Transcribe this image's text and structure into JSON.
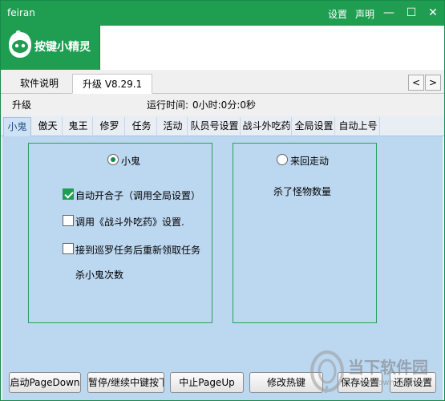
{
  "titlebar": {
    "app_name": "feiran",
    "settings_label": "设置",
    "statement_label": "声明",
    "minimize": "—",
    "maximize": "☐",
    "close": "✕"
  },
  "banner": {
    "logo_text": "按键小精灵"
  },
  "top_tabs": [
    {
      "label": "软件说明"
    },
    {
      "label": "升级 V8.29.1"
    }
  ],
  "top_nav": {
    "prev": "<",
    "next": ">"
  },
  "info": {
    "left_label": "升级",
    "runtime_label": "运行时间:",
    "runtime_value": "0小时:0分:0秒"
  },
  "sub_tabs": [
    {
      "label": "小鬼"
    },
    {
      "label": "傲天"
    },
    {
      "label": "鬼王"
    },
    {
      "label": "修罗"
    },
    {
      "label": "任务"
    },
    {
      "label": "活动"
    },
    {
      "label": "队员号设置"
    },
    {
      "label": "战斗外吃药"
    },
    {
      "label": "全局设置"
    },
    {
      "label": "自动上号"
    }
  ],
  "left_panel": {
    "radio_label": "小鬼",
    "radio_checked": true,
    "checkboxes": [
      {
        "label": "自动开合子（调用全局设置）",
        "checked": true
      },
      {
        "label": "调用《战斗外吃药》设置.",
        "checked": false
      },
      {
        "label": "接到巡罗任务后重新领取任务",
        "checked": false
      }
    ],
    "count_label": "杀小鬼次数"
  },
  "right_panel": {
    "radio_label": "来回走动",
    "radio_checked": false,
    "count_label": "杀了怪物数量"
  },
  "bottom_buttons": [
    {
      "label": "启动PageDown"
    },
    {
      "label": "暂停/继续中键按下"
    },
    {
      "label": "中止PageUp"
    },
    {
      "label": "修改热键"
    },
    {
      "label": "保存设置"
    },
    {
      "label": "还原设置"
    }
  ],
  "watermark": {
    "text": "当下软件园",
    "url": "www.downxia.com"
  },
  "colors": {
    "brand_green": "#1f9e52",
    "content_blue": "#bcd7f0"
  }
}
